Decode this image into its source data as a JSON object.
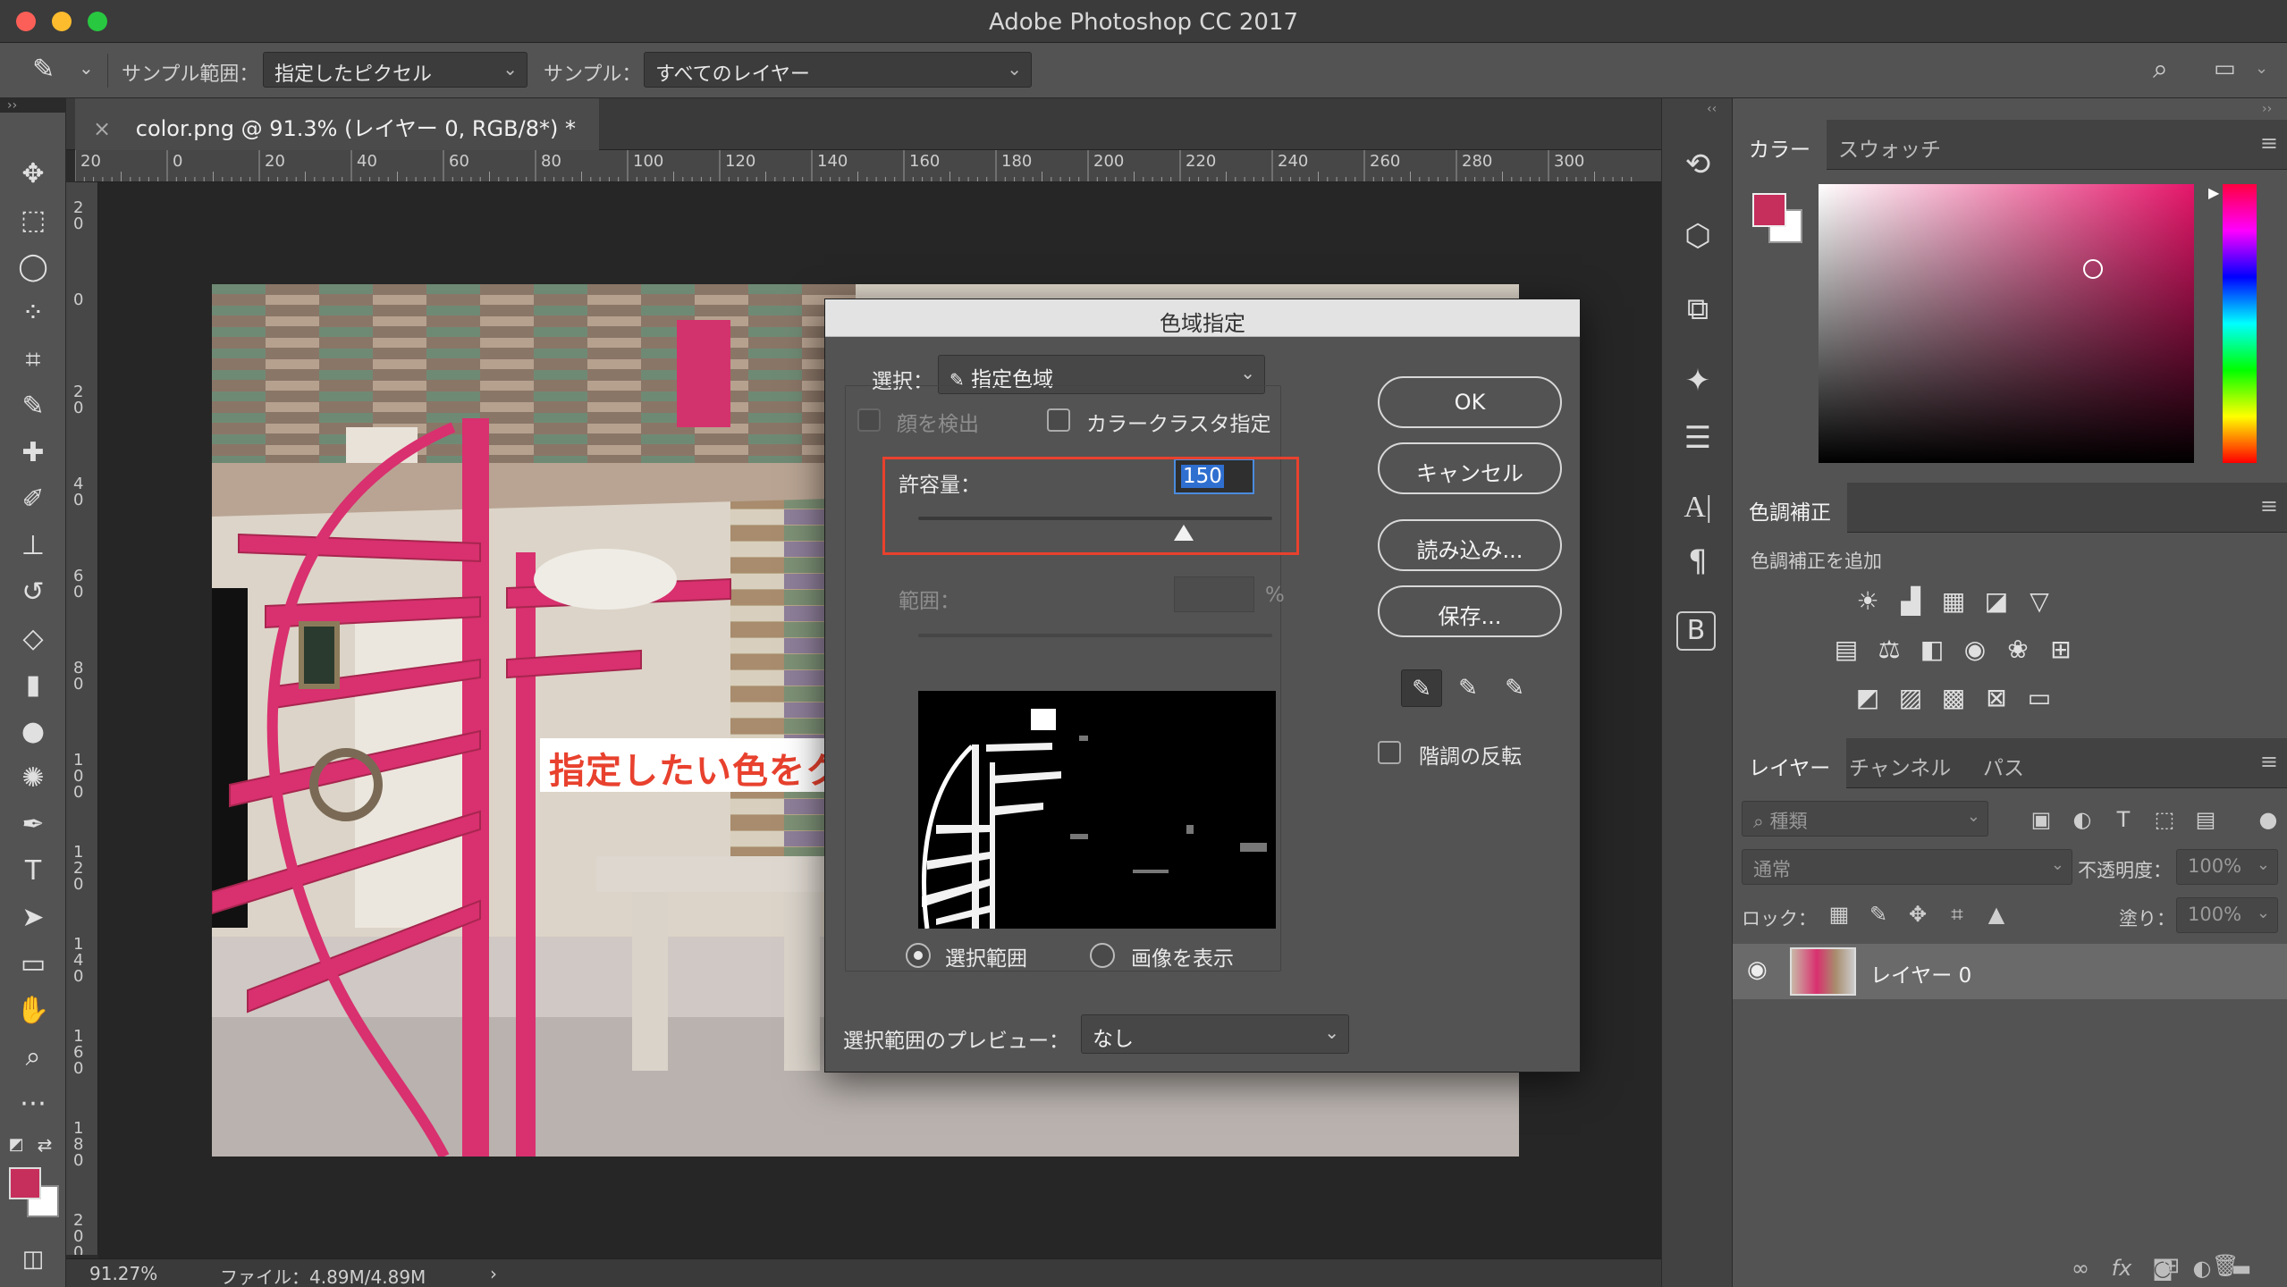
{
  "app": {
    "title": "Adobe Photoshop CC 2017"
  },
  "options_bar": {
    "sample_size_label": "サンプル範囲：",
    "sample_size_value": "指定したピクセル",
    "sample_label": "サンプル：",
    "sample_value": "すべてのレイヤー"
  },
  "document": {
    "tab_title": "color.png @ 91.3% (レイヤー 0, RGB/8*) *",
    "ruler_top_ticks": [
      "20",
      "0",
      "20",
      "40",
      "60",
      "80",
      "100",
      "120",
      "140",
      "160",
      "180",
      "200",
      "220",
      "240",
      "260",
      "280",
      "300"
    ],
    "ruler_left_ticks": [
      "2\n0",
      "0",
      "2\n0",
      "4\n0",
      "6\n0",
      "8\n0",
      "1\n0\n0",
      "1\n2\n0",
      "1\n4\n0",
      "1\n6\n0",
      "1\n8\n0",
      "2\n0\n0"
    ],
    "zoom": "91.27%",
    "file_info": "ファイル：4.89M/4.89M",
    "status_arrow": "›"
  },
  "annotation": {
    "text": "指定したい色をクリック"
  },
  "dialog": {
    "title": "色域指定",
    "select_label": "選択：",
    "select_value": "指定色域",
    "detect_faces_label": "顔を検出",
    "color_clusters_label": "カラークラスタ指定",
    "fuzziness_label": "許容量：",
    "fuzziness_value": "150",
    "fuzziness_fraction": 0.75,
    "range_label": "範囲：",
    "range_unit": "%",
    "radio_selection": "選択範囲",
    "radio_image": "画像を表示",
    "preview_label": "選択範囲のプレビュー：",
    "preview_value": "なし",
    "ok": "OK",
    "cancel": "キャンセル",
    "load": "読み込み...",
    "save": "保存...",
    "invert_label": "階調の反転"
  },
  "panels": {
    "color_tabs": [
      "カラー",
      "スウォッチ"
    ],
    "adjustments_tab": "色調補正",
    "adjustments_add": "色調補正を追加",
    "layers_tabs": [
      "レイヤー",
      "チャンネル",
      "パス"
    ],
    "filter_kind": "種類",
    "blend_mode": "通常",
    "opacity_label": "不透明度：",
    "opacity_value": "100%",
    "lock_label": "ロック：",
    "fill_label": "塗り：",
    "fill_value": "100%",
    "layer_name": "レイヤー 0"
  },
  "colors": {
    "foreground": "#c62e5c",
    "accent_red": "#e8412e",
    "focus_blue": "#2f6fd0"
  },
  "icons": {
    "tools": [
      "move-icon",
      "marquee-icon",
      "lasso-icon",
      "quick-select-icon",
      "crop-icon",
      "eyedropper-icon",
      "healing-icon",
      "brush-icon",
      "stamp-icon",
      "history-brush-icon",
      "eraser-icon",
      "gradient-icon",
      "dodge-icon",
      "blur-icon",
      "pen-icon",
      "type-icon",
      "path-select-icon",
      "shape-icon",
      "hand-icon",
      "zoom-icon",
      "more-icon"
    ]
  }
}
